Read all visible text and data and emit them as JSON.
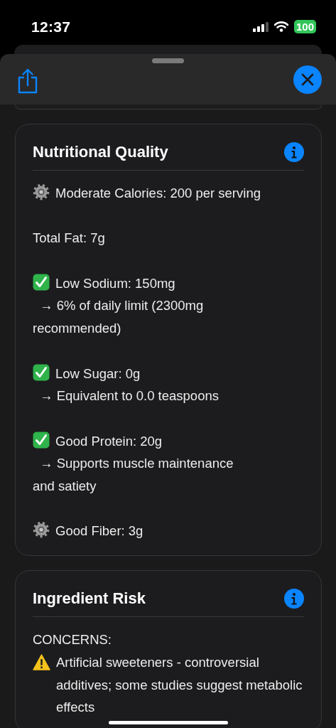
{
  "status_bar": {
    "time": "12:37",
    "battery": "100"
  },
  "sections": [
    {
      "title": "Nutritional Quality",
      "items": [
        {
          "kind": "gear",
          "text": "Moderate Calories: 200 per serving"
        },
        {
          "text": "Total Fat: 7g"
        },
        {
          "kind": "check",
          "text": "Low Sodium: 150mg",
          "note": "→ 6% of daily limit (2300mg recommended)"
        },
        {
          "kind": "check",
          "text": "Low Sugar: 0g",
          "note": "→ Equivalent to 0.0 teaspoons"
        },
        {
          "kind": "check",
          "text": "Good Protein: 20g",
          "note": "→ Supports muscle maintenance and satiety"
        },
        {
          "kind": "gear",
          "text": "Good Fiber: 3g"
        }
      ]
    },
    {
      "title": "Ingredient Risk",
      "label": "CONCERNS:",
      "items": [
        {
          "kind": "warning",
          "text": "Artificial sweeteners - controversial additives; some studies suggest metabolic effects"
        }
      ]
    }
  ]
}
